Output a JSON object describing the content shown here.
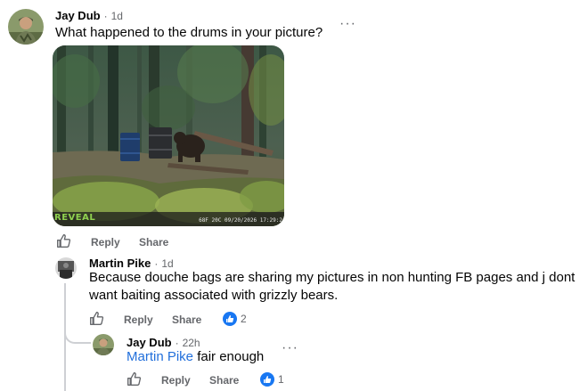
{
  "comments": [
    {
      "author": "Jay Dub",
      "time": "1d",
      "text": "What happened to the drums in your picture?",
      "more": "···",
      "photo": {
        "brand": "REVEAL",
        "stamp": "68F  20C  09/20/2026  17:29:2"
      },
      "actions": {
        "reply": "Reply",
        "share": "Share"
      }
    },
    {
      "author": "Martin Pike",
      "time": "1d",
      "text_line1": "Because douche bags are sharing my pictures in non hunting FB pages and j dont",
      "text_line2": "want baiting associated with grizzly bears.",
      "actions": {
        "reply": "Reply",
        "share": "Share"
      },
      "reaction_count": "2"
    },
    {
      "author": "Jay Dub",
      "time": "22h",
      "mention": "Martin Pike",
      "text": "fair enough",
      "more": "···",
      "actions": {
        "reply": "Reply",
        "share": "Share"
      },
      "reaction_count": "1"
    }
  ],
  "separator": "·",
  "icons": [
    "like-icon",
    "more-options-icon",
    "like-reaction-icon",
    "thumbs-up-icon"
  ],
  "colors": {
    "link": "#216fdb",
    "meta": "#65676b",
    "reaction": "#1877f2",
    "thread_line": "#ced0d4"
  }
}
